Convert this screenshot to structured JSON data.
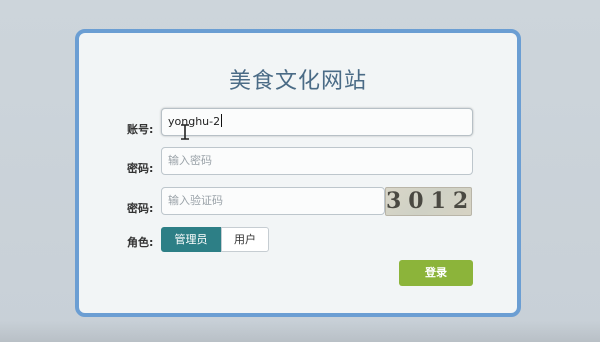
{
  "title": "美食文化网站",
  "form": {
    "account": {
      "label": "账号:",
      "value": "yonghu-2"
    },
    "password": {
      "label": "密码:",
      "placeholder": "输入密码"
    },
    "captcha": {
      "label": "密码:",
      "placeholder": "输入验证码",
      "code": "3012"
    },
    "role": {
      "label": "角色:",
      "options": [
        "管理员",
        "用户"
      ],
      "selected": "管理员"
    },
    "submit_label": "登录"
  },
  "colors": {
    "card_border": "#6b9ed3",
    "role_active": "#2d7f86",
    "login_button": "#8cb43a"
  }
}
